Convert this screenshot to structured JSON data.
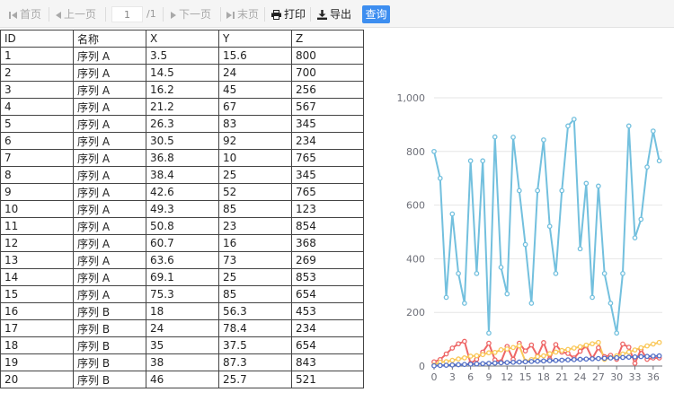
{
  "toolbar": {
    "first": "首页",
    "prev": "上一页",
    "page_value": "1",
    "page_total": "/1",
    "next": "下一页",
    "last": "末页",
    "print": "打印",
    "export": "导出",
    "query": "查询"
  },
  "table": {
    "headers": [
      "ID",
      "名称",
      "X",
      "Y",
      "Z"
    ],
    "rows": [
      [
        "1",
        "序列 A",
        "3.5",
        "15.6",
        "800"
      ],
      [
        "2",
        "序列 A",
        "14.5",
        "24",
        "700"
      ],
      [
        "3",
        "序列 A",
        "16.2",
        "45",
        "256"
      ],
      [
        "4",
        "序列 A",
        "21.2",
        "67",
        "567"
      ],
      [
        "5",
        "序列 A",
        "26.3",
        "83",
        "345"
      ],
      [
        "6",
        "序列 A",
        "30.5",
        "92",
        "234"
      ],
      [
        "7",
        "序列 A",
        "36.8",
        "10",
        "765"
      ],
      [
        "8",
        "序列 A",
        "38.4",
        "25",
        "345"
      ],
      [
        "9",
        "序列 A",
        "42.6",
        "52",
        "765"
      ],
      [
        "10",
        "序列 A",
        "49.3",
        "85",
        "123"
      ],
      [
        "11",
        "序列 A",
        "50.8",
        "23",
        "854"
      ],
      [
        "12",
        "序列 A",
        "60.7",
        "16",
        "368"
      ],
      [
        "13",
        "序列 A",
        "63.6",
        "73",
        "269"
      ],
      [
        "14",
        "序列 A",
        "69.1",
        "25",
        "853"
      ],
      [
        "15",
        "序列 A",
        "75.3",
        "85",
        "654"
      ],
      [
        "16",
        "序列 B",
        "18",
        "56.3",
        "453"
      ],
      [
        "17",
        "序列 B",
        "24",
        "78.4",
        "234"
      ],
      [
        "18",
        "序列 B",
        "35",
        "37.5",
        "654"
      ],
      [
        "19",
        "序列 B",
        "38",
        "87.3",
        "843"
      ],
      [
        "20",
        "序列 B",
        "46",
        "25.7",
        "521"
      ]
    ]
  },
  "colors": {
    "toolbar_bg": "#f5f5f5",
    "query_button": "#3d8ef0",
    "series_z": "#73c0de",
    "series_y": "#ee6666",
    "series_x": "#fac858",
    "series_id": "#5470c6"
  },
  "chart_data": {
    "type": "line",
    "x": [
      0,
      1,
      2,
      3,
      4,
      5,
      6,
      7,
      8,
      9,
      10,
      11,
      12,
      13,
      14,
      15,
      16,
      17,
      18,
      19,
      20,
      21,
      22,
      23,
      24,
      25,
      26,
      27,
      28,
      29,
      30,
      31,
      32,
      33,
      34,
      35,
      36,
      37
    ],
    "xticks": [
      "0",
      "3",
      "6",
      "9",
      "12",
      "15",
      "18",
      "21",
      "24",
      "27",
      "30",
      "33",
      "36"
    ],
    "yticks": [
      "0",
      "200",
      "400",
      "600",
      "800",
      "1,000"
    ],
    "ylim": [
      0,
      1000
    ],
    "grid": true,
    "legend": "none",
    "series": [
      {
        "key": "z",
        "color": "#73c0de",
        "values": [
          800,
          700,
          256,
          567,
          345,
          234,
          765,
          345,
          765,
          123,
          854,
          368,
          269,
          853,
          654,
          453,
          234,
          654,
          843,
          521,
          345,
          654,
          895,
          920,
          437,
          681,
          256,
          671,
          345,
          234,
          123,
          345,
          895,
          478,
          547,
          742,
          876,
          765
        ]
      },
      {
        "key": "y",
        "color": "#ee6666",
        "values": [
          15.6,
          24,
          45,
          67,
          83,
          92,
          10,
          25,
          52,
          85,
          23,
          16,
          73,
          25,
          85,
          56.3,
          78.4,
          37.5,
          87.3,
          25.7,
          80,
          52,
          47,
          30,
          55,
          75,
          28,
          68,
          35,
          40,
          25,
          82,
          70,
          10,
          62,
          25,
          30,
          30
        ]
      },
      {
        "key": "x",
        "color": "#fac858",
        "values": [
          3.5,
          14.5,
          16.2,
          21.2,
          26.3,
          30.5,
          36.8,
          38.4,
          42.6,
          49.3,
          50.8,
          60.7,
          63.6,
          69.1,
          75.3,
          18,
          24,
          35,
          38,
          46,
          52,
          58,
          62,
          67,
          72,
          78,
          83,
          88,
          25,
          31,
          38,
          45,
          52,
          60,
          68,
          75,
          82,
          88
        ]
      },
      {
        "key": "id",
        "color": "#5470c6",
        "values": [
          1,
          2,
          3,
          4,
          5,
          6,
          7,
          8,
          9,
          10,
          11,
          12,
          13,
          14,
          15,
          16,
          17,
          18,
          19,
          20,
          21,
          22,
          23,
          24,
          25,
          26,
          27,
          28,
          29,
          30,
          31,
          32,
          33,
          34,
          35,
          36,
          37,
          38
        ]
      }
    ]
  }
}
